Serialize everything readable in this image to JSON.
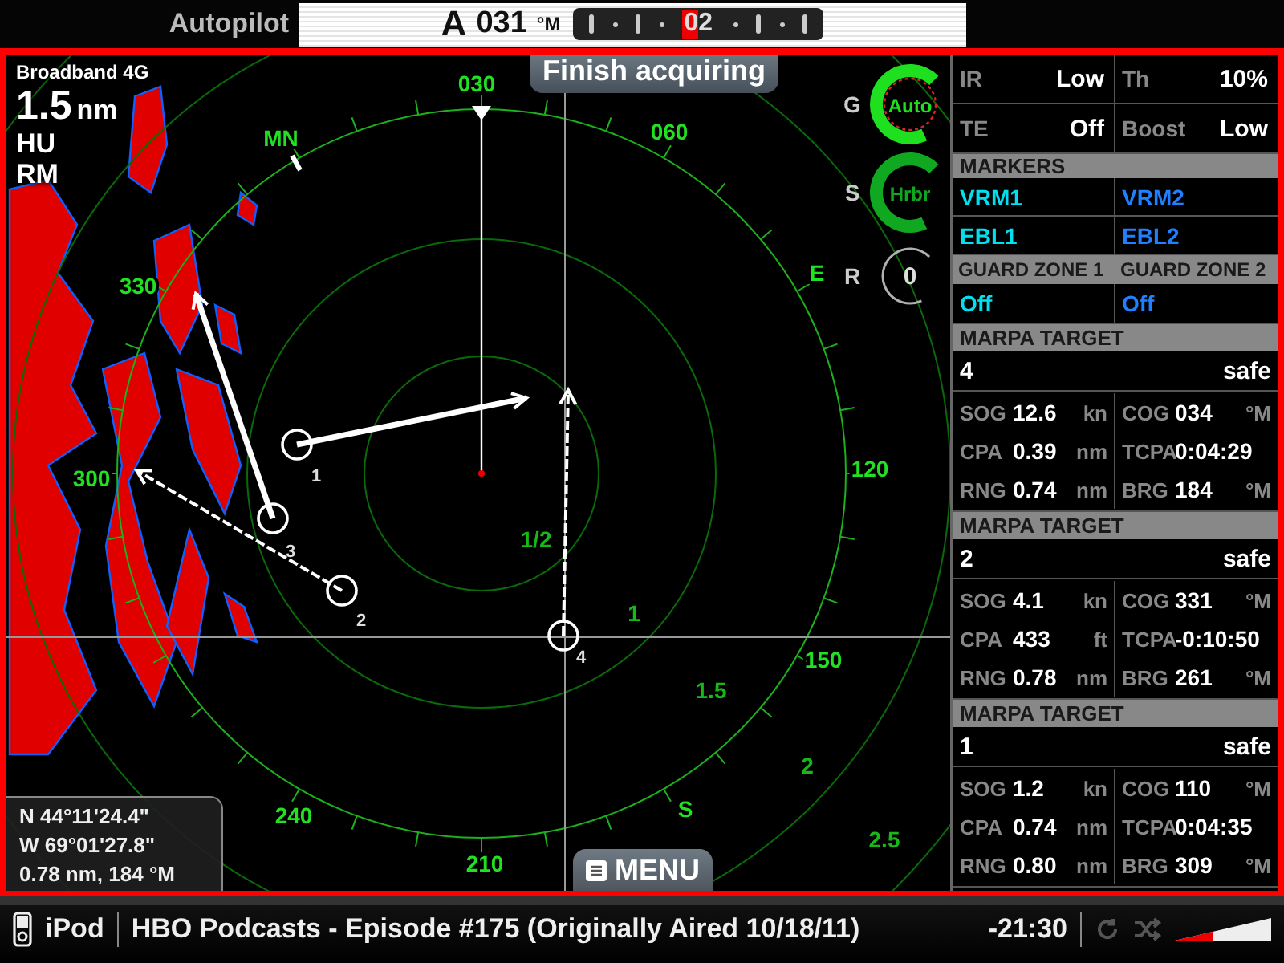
{
  "top_bar": {
    "label": "Autopilot",
    "mode": "A",
    "heading": "031",
    "unit": "°M",
    "rudder_reading": "02"
  },
  "radar": {
    "source": "Broadband 4G",
    "range": "1.5",
    "range_unit": "nm",
    "orientation": "HU",
    "motion": "RM",
    "banner": "Finish acquiring",
    "bearing_labels": [
      "030",
      "060",
      "120",
      "150",
      "210",
      "240",
      "300",
      "330",
      "MN",
      "E",
      "S"
    ],
    "range_labels": [
      "1/2",
      "1",
      "1.5",
      "2",
      "2.5"
    ],
    "targets": [
      "1",
      "2",
      "3",
      "4"
    ],
    "controls": [
      {
        "letter": "G",
        "value": "Auto",
        "color": "#1fe01f"
      },
      {
        "letter": "S",
        "value": "Hrbr",
        "color": "#10a820"
      },
      {
        "letter": "R",
        "value": "0",
        "color": "#b0b0b0"
      }
    ],
    "cursor_info": [
      "N 44°11'24.4\"",
      "W 69°01'27.8\"",
      "0.78 nm, 184 °M"
    ],
    "menu_button": "MENU"
  },
  "panel": {
    "settings": [
      {
        "label": "IR",
        "value": "Low"
      },
      {
        "label": "Th",
        "value": "10%"
      },
      {
        "label": "TE",
        "value": "Off"
      },
      {
        "label": "Boost",
        "value": "Low"
      }
    ],
    "markers": {
      "title": "MARKERS",
      "items": [
        {
          "label": "VRM1",
          "color": "#00e0f0"
        },
        {
          "label": "VRM2",
          "color": "#2080ff"
        },
        {
          "label": "EBL1",
          "color": "#00e0f0"
        },
        {
          "label": "EBL2",
          "color": "#2080ff"
        }
      ]
    },
    "guard_zones": [
      {
        "title": "GUARD ZONE 1",
        "value": "Off",
        "color": "#00e0f0"
      },
      {
        "title": "GUARD ZONE 2",
        "value": "Off",
        "color": "#2080ff"
      }
    ],
    "targets": [
      {
        "title": "MARPA TARGET",
        "id": "4",
        "status": "safe",
        "fields": [
          {
            "label": "SOG",
            "value": "12.6",
            "unit": "kn"
          },
          {
            "label": "COG",
            "value": "034",
            "unit": "°M"
          },
          {
            "label": "CPA",
            "value": "0.39",
            "unit": "nm"
          },
          {
            "label": "TCPA",
            "value": "0:04:29"
          },
          {
            "label": "RNG",
            "value": "0.74",
            "unit": "nm"
          },
          {
            "label": "BRG",
            "value": "184",
            "unit": "°M"
          }
        ]
      },
      {
        "title": "MARPA TARGET",
        "id": "2",
        "status": "safe",
        "fields": [
          {
            "label": "SOG",
            "value": "4.1",
            "unit": "kn"
          },
          {
            "label": "COG",
            "value": "331",
            "unit": "°M"
          },
          {
            "label": "CPA",
            "value": "433",
            "unit": "ft"
          },
          {
            "label": "TCPA",
            "value": "-0:10:50"
          },
          {
            "label": "RNG",
            "value": "0.78",
            "unit": "nm"
          },
          {
            "label": "BRG",
            "value": "261",
            "unit": "°M"
          }
        ]
      },
      {
        "title": "MARPA TARGET",
        "id": "1",
        "status": "safe",
        "fields": [
          {
            "label": "SOG",
            "value": "1.2",
            "unit": "kn"
          },
          {
            "label": "COG",
            "value": "110",
            "unit": "°M"
          },
          {
            "label": "CPA",
            "value": "0.74",
            "unit": "nm"
          },
          {
            "label": "TCPA",
            "value": "0:04:35"
          },
          {
            "label": "RNG",
            "value": "0.80",
            "unit": "nm"
          },
          {
            "label": "BRG",
            "value": "309",
            "unit": "°M"
          }
        ]
      }
    ]
  },
  "media_bar": {
    "source": "iPod",
    "title": "HBO Podcasts - Episode #175 (Originally Aired 10/18/11)",
    "time": "-21:30",
    "volume": {
      "level": 0.4
    }
  }
}
